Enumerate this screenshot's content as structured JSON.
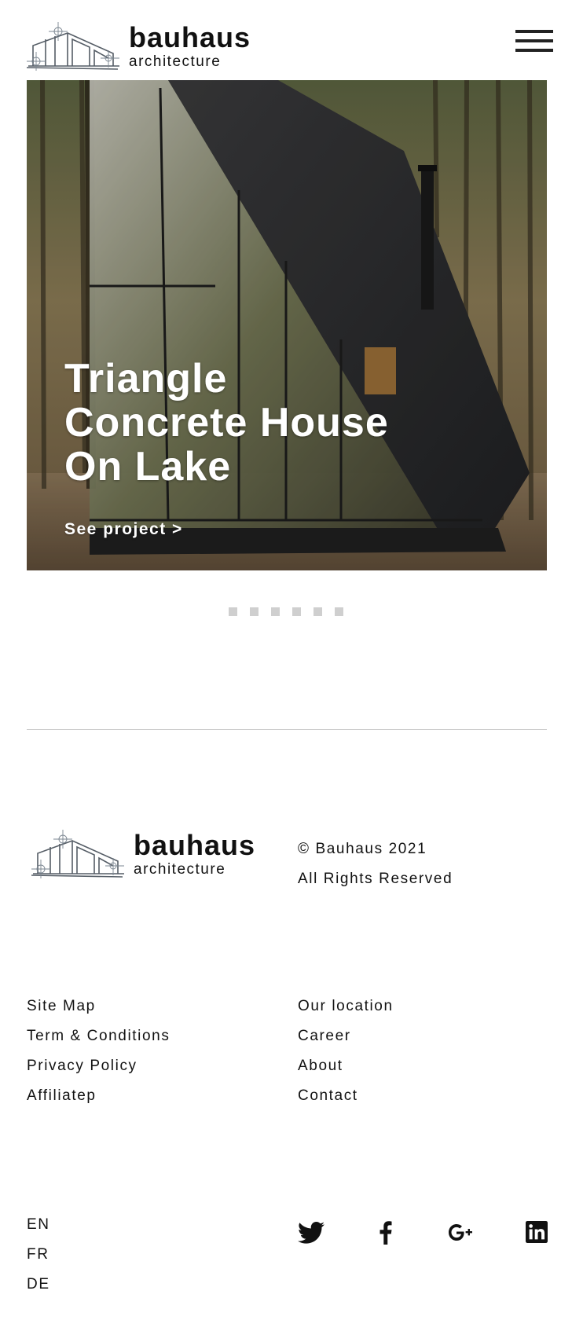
{
  "brand": {
    "name": "bauhaus",
    "subtitle": "architecture"
  },
  "header": {
    "menu_icon": "hamburger-menu-icon"
  },
  "hero": {
    "title": "Triangle\nConcrete House\nOn Lake",
    "link_label": "See project  >"
  },
  "carousel": {
    "dot_count": 6,
    "dot_color": "#cfcfcf"
  },
  "footer": {
    "copyright_line1": "© Bauhaus 2021",
    "copyright_line2": "All Rights Reserved",
    "links_left": [
      "Site Map",
      "Term & Conditions",
      "Privacy Policy",
      "Affiliatep"
    ],
    "links_right": [
      "Our location",
      "Career",
      "About",
      "Contact"
    ],
    "languages": [
      "EN",
      "FR",
      "DE"
    ],
    "social_icons": [
      "twitter-icon",
      "facebook-icon",
      "google-plus-icon",
      "linkedin-icon"
    ]
  },
  "colors": {
    "text": "#111111",
    "divider": "#cccccc",
    "hero_text": "#ffffff"
  }
}
